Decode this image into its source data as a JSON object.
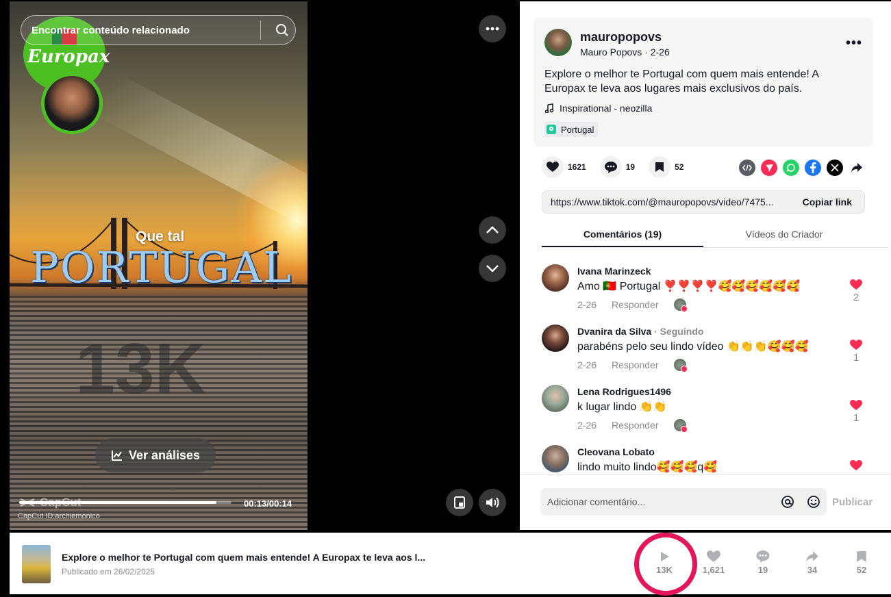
{
  "video": {
    "search_placeholder": "Encontrar conteúdo relacionado",
    "brand": "Europax",
    "headline_small": "Que tal",
    "headline_big": "PORTUGAL",
    "watermark_views": "13K",
    "analysis_button": "Ver análises",
    "capcut_label": "CapCut",
    "capcut_id": "CapCut ID:archiemonico",
    "time": "00:13/00:14",
    "progress": 0.93
  },
  "author": {
    "username": "mauropopovs",
    "subline": "Mauro Popovs · 2-26",
    "description": "Explore o melhor te Portugal com quem mais entende! A Europax te leva aos lugares mais exclusivos do país.",
    "music": "Inspirational - neozilla",
    "location": "Portugal"
  },
  "actions": {
    "likes": "1621",
    "comments": "19",
    "saves": "52"
  },
  "share_icons": [
    "embed-icon",
    "send-icon",
    "whatsapp-icon",
    "facebook-icon",
    "x-icon",
    "share-arrow-icon"
  ],
  "link": {
    "url": "https://www.tiktok.com/@mauropopovs/video/7475...",
    "copy_label": "Copiar link"
  },
  "tabs": [
    {
      "label": "Comentários (19)"
    },
    {
      "label": "Vídeos do Criador"
    }
  ],
  "comments": [
    {
      "user": "Ivana Marinzeck",
      "following": "",
      "text": "Amo 🇵🇹 Portugal ❣️❣️❣️❣️🥰🥰🥰🥰🥰🥰",
      "date": "2-26",
      "reply": "Responder",
      "likes": "2",
      "avatar_color": "#7a4a3a"
    },
    {
      "user": "Dvanira da Silva",
      "following": "· Seguindo",
      "text": "parabéns pelo seu lindo vídeo 👏👏👏🥰🥰🥰",
      "date": "2-26",
      "reply": "Responder",
      "likes": "1",
      "avatar_color": "#3b2a2a"
    },
    {
      "user": "Lena Rodrigues1496",
      "following": "",
      "text": "k lugar lindo 👏👏",
      "date": "2-26",
      "reply": "Responder",
      "likes": "1",
      "avatar_color": "#8a9c8a"
    },
    {
      "user": "Cleovana Lobato",
      "following": "",
      "text": "lindo muito lindo🥰🥰🥰q🥰",
      "date": "",
      "reply": "",
      "likes": "",
      "avatar_color": "#9a8070"
    }
  ],
  "comment_input": {
    "placeholder": "Adicionar comentário...",
    "publish_label": "Publicar"
  },
  "bottom_bar": {
    "title": "Explore o melhor te Portugal com quem mais entende! A Europax te leva aos l...",
    "published": "Publicado em 26/02/2025",
    "stats": {
      "views": "13K",
      "likes": "1,621",
      "comments": "19",
      "shares": "34",
      "saves": "52"
    }
  },
  "colors": {
    "accent": "#fe2c55",
    "highlight_ring": "#e6145a",
    "logo_green": "#4cc022"
  }
}
